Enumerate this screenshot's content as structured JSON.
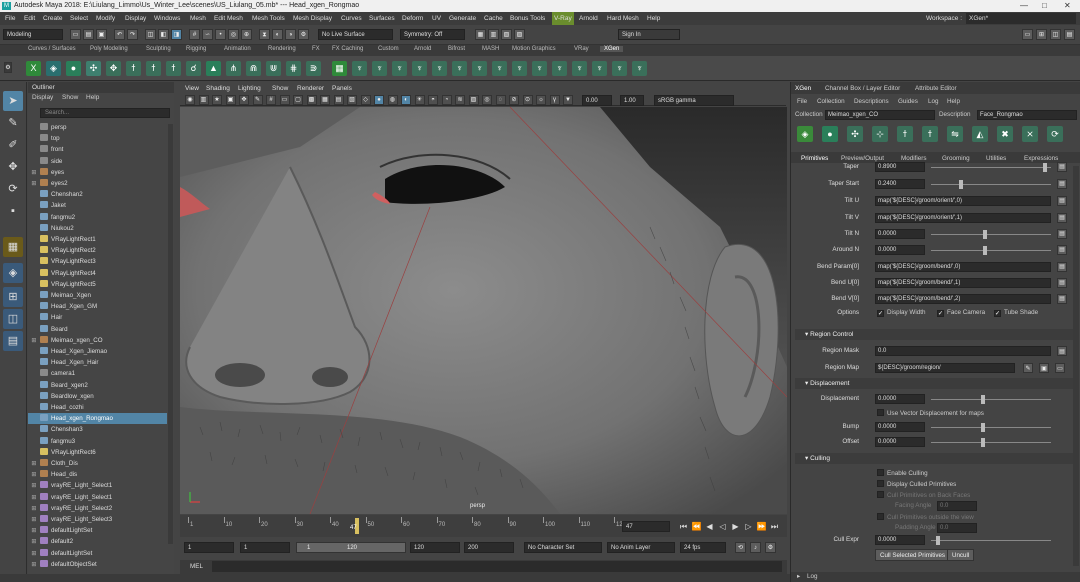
{
  "window": {
    "title": "Autodesk Maya 2018: E:\\Liulang_Limmo\\Us_Winter_Lee\\scenes\\US_Liulang_05.mb*  ---  Head_xgen_Rongmao",
    "maya_badge": "M",
    "min": "—",
    "max": "□",
    "close": "✕"
  },
  "menubar": {
    "items": [
      "File",
      "Edit",
      "Create",
      "Select",
      "Modify",
      "Display",
      "Windows",
      "Mesh",
      "Edit Mesh",
      "Mesh Tools",
      "Mesh Display",
      "Curves",
      "Surfaces",
      "Deform",
      "UV",
      "Generate",
      "Cache",
      "Bonus Tools",
      "V-Ray",
      "Arnold",
      "Hard Mesh",
      "Help"
    ],
    "workspace_label": "Workspace :",
    "workspace_value": "XGen*"
  },
  "statusline": {
    "mode": "Modeling",
    "live_surface": "No Live Surface",
    "symmetry": "Symmetry: Off",
    "sign_in": "Sign In"
  },
  "shelf_tabs": [
    "Curves / Surfaces",
    "Poly Modeling",
    "Sculpting",
    "Rigging",
    "Animation",
    "Rendering",
    "FX",
    "FX Caching",
    "Custom",
    "Arnold",
    "Bifrost",
    "MASH",
    "Motion Graphics",
    "VRay",
    "XGen"
  ],
  "active_shelf_tab": "XGen",
  "outliner": {
    "title": "Outliner",
    "menu": [
      "Display",
      "Show",
      "Help"
    ],
    "search_placeholder": "Search...",
    "items": [
      {
        "label": "persp",
        "type": "camera"
      },
      {
        "label": "top",
        "type": "camera"
      },
      {
        "label": "front",
        "type": "camera"
      },
      {
        "label": "side",
        "type": "camera"
      },
      {
        "label": "eyes",
        "type": "group"
      },
      {
        "label": "eyes2",
        "type": "group"
      },
      {
        "label": "Chenshan2",
        "type": "mesh"
      },
      {
        "label": "Jaket",
        "type": "mesh"
      },
      {
        "label": "fangmu2",
        "type": "mesh"
      },
      {
        "label": "Niukou2",
        "type": "mesh"
      },
      {
        "label": "VRayLightRect1",
        "type": "light"
      },
      {
        "label": "VRayLightRect2",
        "type": "light"
      },
      {
        "label": "VRayLightRect3",
        "type": "light"
      },
      {
        "label": "VRayLightRect4",
        "type": "light"
      },
      {
        "label": "VRayLightRect5",
        "type": "light"
      },
      {
        "label": "Meimao_Xgen",
        "type": "mesh"
      },
      {
        "label": "Head_Xgen_GM",
        "type": "mesh"
      },
      {
        "label": "Hair",
        "type": "mesh"
      },
      {
        "label": "Beard",
        "type": "mesh"
      },
      {
        "label": "Meimao_xgen_CO",
        "type": "group"
      },
      {
        "label": "Head_Xgen_Jiemao",
        "type": "mesh"
      },
      {
        "label": "Head_Xgen_Hair",
        "type": "mesh"
      },
      {
        "label": "camera1",
        "type": "camera"
      },
      {
        "label": "Beard_xgen2",
        "type": "mesh"
      },
      {
        "label": "Beardlow_xgen",
        "type": "mesh"
      },
      {
        "label": "Head_cozhi",
        "type": "mesh"
      },
      {
        "label": "Head_xgen_Rongmao",
        "type": "mesh"
      },
      {
        "label": "Chenshan3",
        "type": "mesh"
      },
      {
        "label": "fangmu3",
        "type": "mesh"
      },
      {
        "label": "VRayLightRect6",
        "type": "light"
      },
      {
        "label": "Cloth_Dis",
        "type": "group"
      },
      {
        "label": "Head_dis",
        "type": "group"
      },
      {
        "label": "vrayRE_Light_Select1",
        "type": "set"
      },
      {
        "label": "vrayRE_Light_Select1",
        "type": "set"
      },
      {
        "label": "vrayRE_Light_Select2",
        "type": "set"
      },
      {
        "label": "vrayRE_Light_Select3",
        "type": "set"
      },
      {
        "label": "defaultLightSet",
        "type": "set"
      },
      {
        "label": "default2",
        "type": "set"
      },
      {
        "label": "defaultLightSet",
        "type": "set"
      },
      {
        "label": "defaultObjectSet",
        "type": "set"
      }
    ],
    "selected_index": 26
  },
  "viewport": {
    "menu": [
      "View",
      "Shading",
      "Lighting",
      "Show",
      "Renderer",
      "Panels"
    ],
    "exposure": "0.00",
    "gamma": "1.00",
    "colorspace": "sRGB gamma",
    "camera_label": "persp"
  },
  "timeline": {
    "ticks": [
      "1",
      "10",
      "20",
      "30",
      "40",
      "50",
      "60",
      "70",
      "80",
      "90",
      "100",
      "110",
      "120"
    ],
    "current_frame": "47",
    "current_field": "47"
  },
  "range": {
    "start": "1",
    "start2": "1",
    "slider_start": "1",
    "slider_end": "120",
    "end": "120",
    "end2": "200",
    "character_set": "No Character Set",
    "anim_layer": "No Anim Layer",
    "fps": "24 fps"
  },
  "mel": {
    "label": "MEL"
  },
  "xgen": {
    "tabs_top": [
      "XGen",
      "Channel Box / Layer Editor",
      "Attribute Editor"
    ],
    "menu": [
      "File",
      "Collection",
      "Descriptions",
      "Guides",
      "Log",
      "Help"
    ],
    "collection_label": "Collection",
    "collection_value": "Meimao_xgen_CO",
    "description_label": "Description",
    "description_value": "Face_Rongmao",
    "subtabs": [
      "Primitives",
      "Preview/Output",
      "Modifiers",
      "Grooming",
      "Utilities",
      "Expressions"
    ],
    "attrs": [
      {
        "label": "Taper",
        "value": "0.8900"
      },
      {
        "label": "Taper Start",
        "value": "0.2400"
      },
      {
        "label": "Tilt U",
        "value": "map('${DESC}/groom/orient/',0)"
      },
      {
        "label": "Tilt V",
        "value": "map('${DESC}/groom/orient/',1)"
      },
      {
        "label": "Tilt N",
        "value": "0.0000"
      },
      {
        "label": "Around N",
        "value": "0.0000"
      },
      {
        "label": "Bend Param[0]",
        "value": "map('${DESC}/groom/bend/',0)"
      },
      {
        "label": "Bend U[0]",
        "value": "map('${DESC}/groom/bend/',1)"
      },
      {
        "label": "Bend V[0]",
        "value": "map('${DESC}/groom/bend/',2)"
      }
    ],
    "options_label": "Options",
    "options": [
      "Display Width",
      "Face Camera",
      "Tube Shade"
    ],
    "region_control": "Region Control",
    "region_mask_label": "Region Mask",
    "region_mask_value": "0.0",
    "region_map_label": "Region Map",
    "region_map_value": "${DESC}/groom/region/",
    "displacement_section": "Displacement",
    "displacement_label": "Displacement",
    "displacement_value": "0.0000",
    "use_vector_disp": "Use Vector Displacement for maps",
    "bump_label": "Bump",
    "bump_value": "0.0000",
    "offset_label": "Offset",
    "offset_value": "0.0000",
    "culling_section": "Culling",
    "enable_culling": "Enable Culling",
    "display_culled": "Display Culled Primitives",
    "cull_backfaces": "Cull Primitives on Back Faces",
    "facing_angle_label": "Facing Angle",
    "facing_angle_value": "0.0",
    "cull_outside": "Cull Primitives outside the view",
    "padding_label": "Padding Angle",
    "padding_value": "0.0",
    "cull_expr_label": "Cull Expr",
    "cull_expr_value": "0.0000",
    "cull_selected_btn": "Cull Selected Primitives",
    "uncull_btn": "Uncull",
    "log_label": "Log"
  }
}
